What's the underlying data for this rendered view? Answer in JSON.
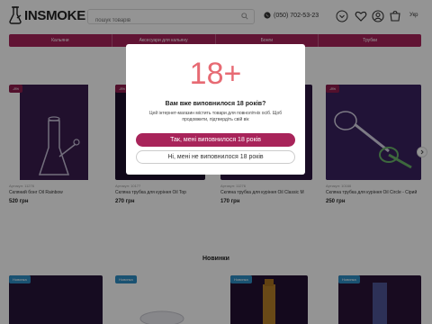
{
  "header": {
    "logo_text": "INSMOKE",
    "search_placeholder": "пошук товарів",
    "phone": "(050) 702-53-23",
    "lang": "Укр"
  },
  "nav": {
    "items": [
      "Кальяни",
      "Аксесуари для кальяну",
      "Бонги",
      "Трубки"
    ]
  },
  "products": [
    {
      "badge": "-8%",
      "meta": "Артикул: 11276",
      "title": "Скляний бонг Oil Rainbow",
      "price": "520 грн"
    },
    {
      "badge": "-8%",
      "meta": "Артикул: 10177",
      "title": "Скляна трубка для куріння Oil Top",
      "price": "270 грн"
    },
    {
      "badge": "",
      "meta": "Артикул: 11276",
      "title": "Скляна трубка для куріння Oil Classic M",
      "price": "170 грн"
    },
    {
      "badge": "-8%",
      "meta": "Артикул: 10166",
      "title": "Скляна трубка для куріння Oil Circle - Сірий",
      "price": "250 грн"
    }
  ],
  "section_new": "Новинки",
  "new_products": [
    {
      "badge": "Новинка"
    },
    {
      "badge": "Новинка"
    },
    {
      "badge": "Новинка"
    },
    {
      "badge": "Новинка"
    }
  ],
  "modal": {
    "age": "18+",
    "question": "Вам вже виповнилося 18 років?",
    "description": "Цей інтернет-магазин містить товари для повнолітніх осіб. Щоб продовжити, підтвердіть свій вік",
    "yes_label": "Так, мені виповнилося 18 років",
    "no_label": "Ні, мені не виповнилося 18 років"
  },
  "colors": {
    "brand": "#a8245a",
    "age_text": "#e76a73"
  }
}
